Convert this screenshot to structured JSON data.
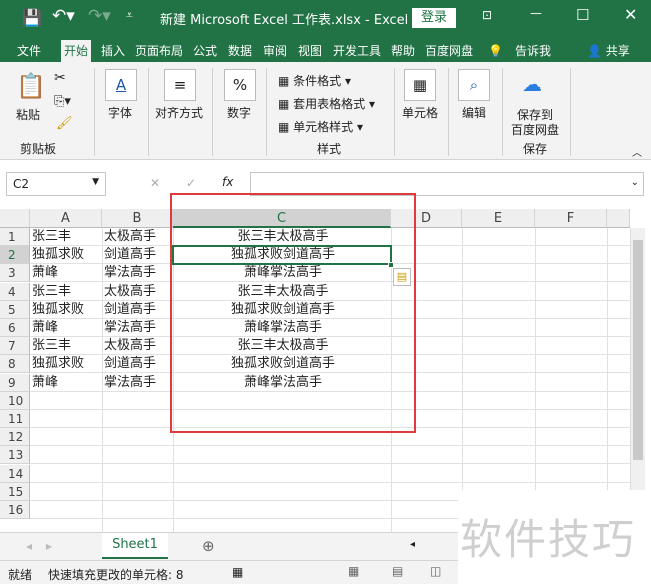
{
  "title_bar": {
    "title": "新建 Microsoft Excel 工作表.xlsx  -  Excel",
    "login": "登录"
  },
  "tabs": [
    "文件",
    "开始",
    "插入",
    "页面布局",
    "公式",
    "数据",
    "审阅",
    "视图",
    "开发工具",
    "帮助",
    "百度网盘",
    "告诉我",
    "共享"
  ],
  "ribbon": {
    "paste": "粘贴",
    "clipboard": "剪贴板",
    "font": "字体",
    "align": "对齐方式",
    "number": "数字",
    "cond": "条件格式",
    "table": "套用表格格式",
    "cellstyle": "单元格样式",
    "styles": "样式",
    "cells": "单元格",
    "edit": "编辑",
    "save1": "保存到",
    "save2": "百度网盘",
    "save_grp": "保存"
  },
  "formula_bar": {
    "name_box": "C2",
    "fx": "fx",
    "value": ""
  },
  "columns": [
    "A",
    "B",
    "C",
    "D",
    "E",
    "F"
  ],
  "rows": [
    [
      "张三丰",
      "太极高手",
      "张三丰太极高手"
    ],
    [
      "独孤求败",
      "剑道高手",
      "独孤求败剑道高手"
    ],
    [
      "萧峰",
      "掌法高手",
      "萧峰掌法高手"
    ],
    [
      "张三丰",
      "太极高手",
      "张三丰太极高手"
    ],
    [
      "独孤求败",
      "剑道高手",
      "独孤求败剑道高手"
    ],
    [
      "萧峰",
      "掌法高手",
      "萧峰掌法高手"
    ],
    [
      "张三丰",
      "太极高手",
      "张三丰太极高手"
    ],
    [
      "独孤求败",
      "剑道高手",
      "独孤求败剑道高手"
    ],
    [
      "萧峰",
      "掌法高手",
      "萧峰掌法高手"
    ]
  ],
  "row_numbers": [
    "1",
    "2",
    "3",
    "4",
    "5",
    "6",
    "7",
    "8",
    "9",
    "10",
    "11",
    "12",
    "13",
    "14",
    "15",
    "16"
  ],
  "sheet_tab": "Sheet1",
  "status": {
    "ready": "就绪",
    "flash_fill": "快速填充更改的单元格: 8"
  },
  "watermark": "软件技巧",
  "colors": {
    "excel_green": "#217346",
    "highlight_red": "#e0393e"
  }
}
